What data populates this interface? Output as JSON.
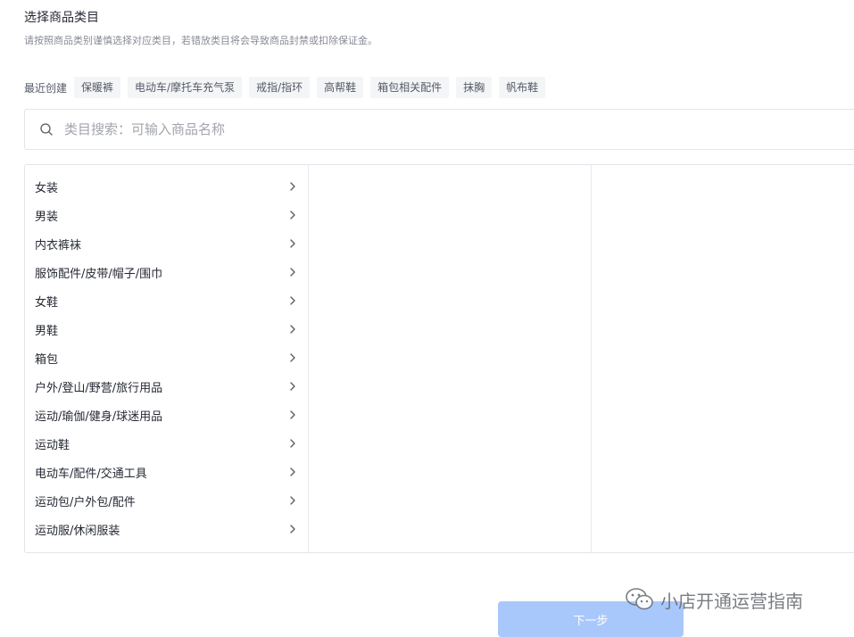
{
  "header": {
    "title": "选择商品类目",
    "subtitle": "请按照商品类别谨慎选择对应类目，若错放类目将会导致商品封禁或扣除保证金。"
  },
  "recent": {
    "label": "最近创建",
    "chips": [
      "保暖裤",
      "电动车/摩托车充气泵",
      "戒指/指环",
      "高帮鞋",
      "箱包相关配件",
      "抹胸",
      "帆布鞋"
    ]
  },
  "search": {
    "icon": "search-icon",
    "placeholder": "类目搜索：可输入商品名称"
  },
  "categories": [
    "女装",
    "男装",
    "内衣裤袜",
    "服饰配件/皮带/帽子/围巾",
    "女鞋",
    "男鞋",
    "箱包",
    "户外/登山/野营/旅行用品",
    "运动/瑜伽/健身/球迷用品",
    "运动鞋",
    "电动车/配件/交通工具",
    "运动包/户外包/配件",
    "运动服/休闲服装"
  ],
  "footer": {
    "next_label": "下一步",
    "next_color": "#a8c8fb"
  },
  "watermark": {
    "text": "小店开通运营指南",
    "icon": "wechat-logo-icon"
  }
}
